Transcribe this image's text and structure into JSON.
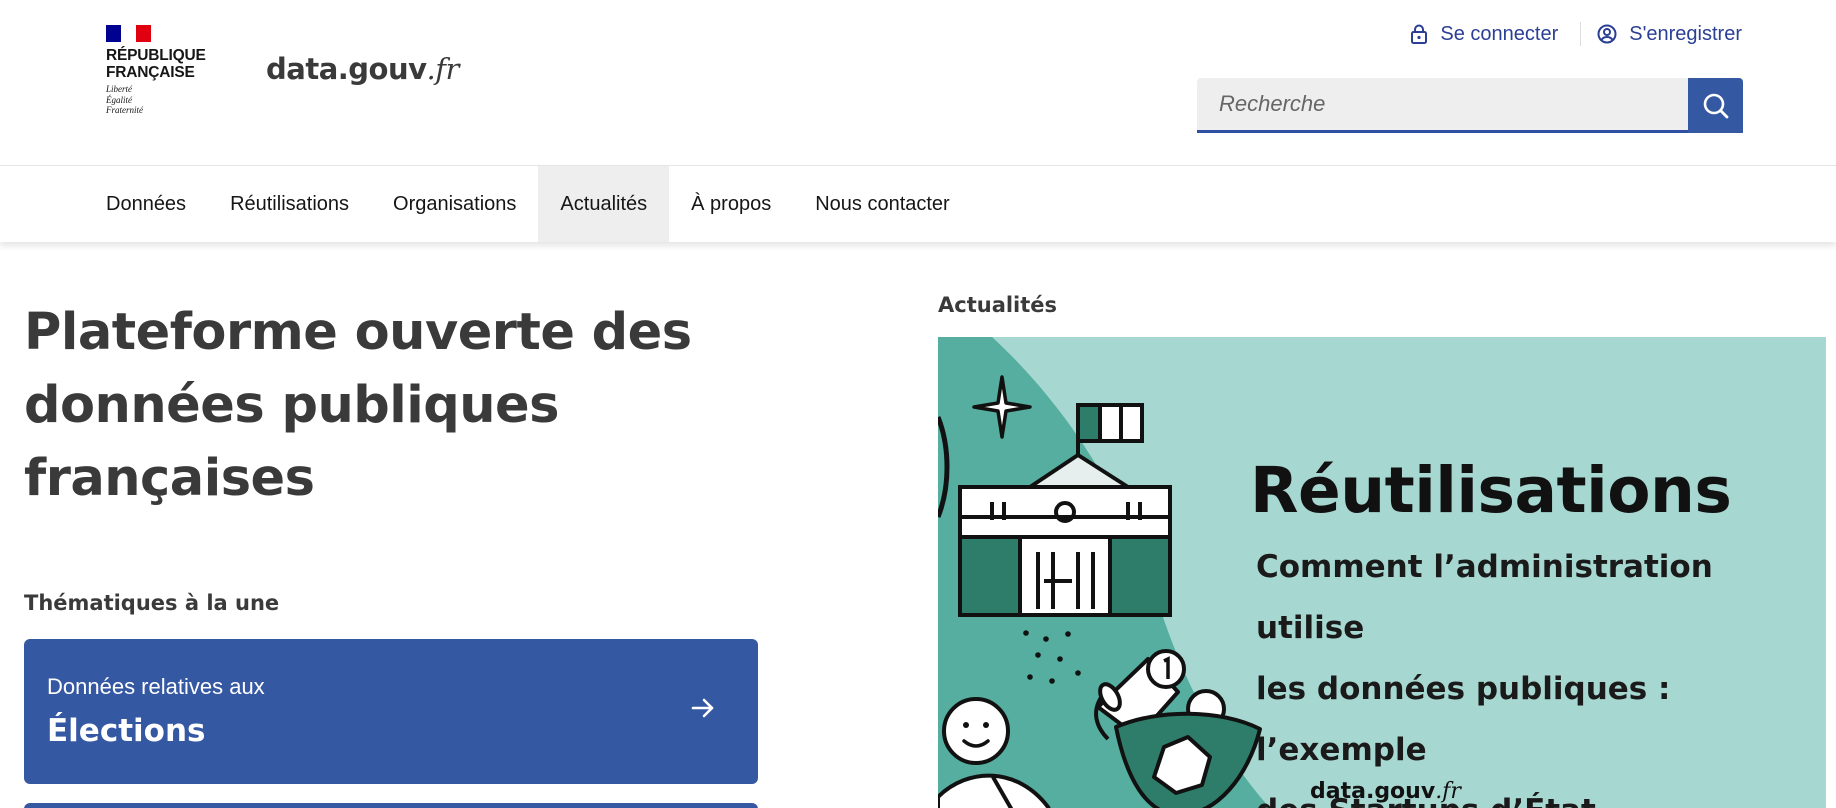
{
  "header": {
    "gov_name_line1": "RÉPUBLIQUE",
    "gov_name_line2": "FRANÇAISE",
    "motto_1": "Liberté",
    "motto_2": "Égalité",
    "motto_3": "Fraternité",
    "site_name": "data.gouv",
    "site_tld": ".fr",
    "login_label": "Se connecter",
    "register_label": "S'enregistrer",
    "search_placeholder": "Recherche"
  },
  "nav": {
    "items": [
      {
        "label": "Données"
      },
      {
        "label": "Réutilisations"
      },
      {
        "label": "Organisations"
      },
      {
        "label": "Actualités",
        "active": true
      },
      {
        "label": "À propos"
      },
      {
        "label": "Nous contacter"
      }
    ]
  },
  "hero": {
    "title_line1": "Plateforme ouverte des",
    "title_line2": "données publiques",
    "title_line3": "françaises"
  },
  "themes": {
    "label": "Thématiques à la une",
    "cards": [
      {
        "subtitle": "Données relatives aux",
        "title": "Élections"
      }
    ]
  },
  "news": {
    "label": "Actualités",
    "banner_title": "Réutilisations",
    "banner_subtitle_1": "Comment l’administration utilise",
    "banner_subtitle_2": "les données publiques : l’exemple",
    "banner_subtitle_3": "des Startups d’État",
    "banner_brand": "data.gouv",
    "banner_brand_tld": ".fr"
  },
  "colors": {
    "primary_blue": "#3558a2",
    "nav_active_bg": "#eeeeee",
    "banner_bg": "#a7d7d1",
    "banner_shape": "#55ae9f"
  }
}
